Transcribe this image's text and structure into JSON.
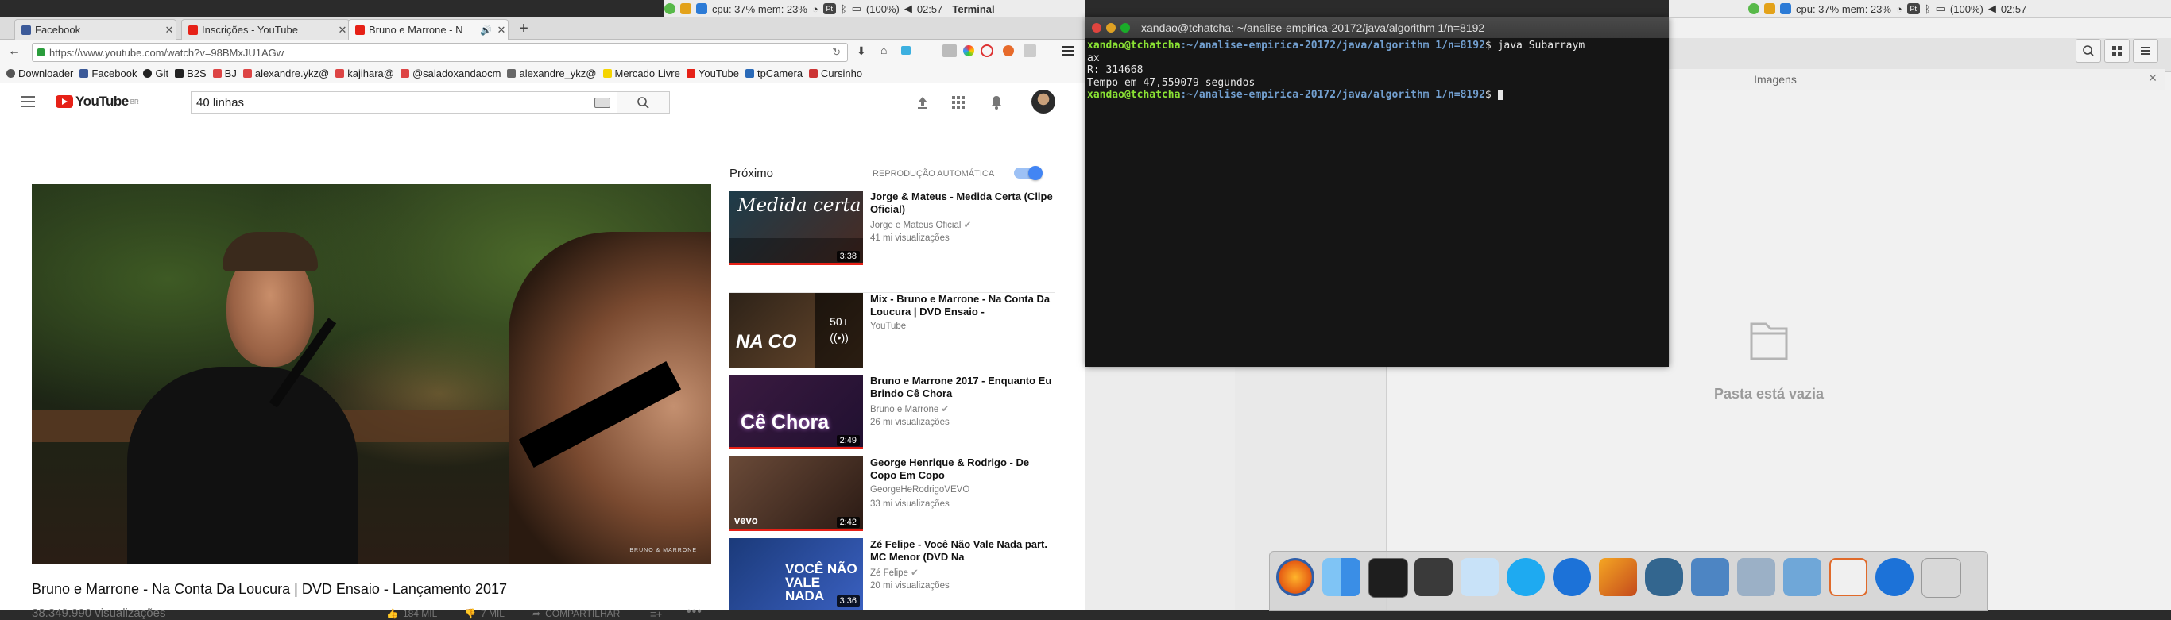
{
  "system_bar": {
    "stats": "cpu: 37% mem: 23%",
    "battery": "(100%)",
    "time": "02:57",
    "app_name": "Terminal",
    "right_stats": "cpu: 37% mem: 23%",
    "right_battery": "(100%)",
    "right_time": "02:57"
  },
  "browser": {
    "tabs": [
      {
        "label": "Facebook",
        "color": "#3b5998"
      },
      {
        "label": "Inscrições - YouTube",
        "color": "#e62117"
      },
      {
        "label": "Bruno e Marrone - N",
        "color": "#e62117"
      }
    ],
    "new_tab": "+",
    "url": "https://www.youtube.com/watch?v=98BMxJU1AGw",
    "bookmarks": [
      {
        "label": "Downloader",
        "color": "#555"
      },
      {
        "label": "Facebook",
        "color": "#3b5998"
      },
      {
        "label": "Git",
        "color": "#222"
      },
      {
        "label": "B2S",
        "color": "#222"
      },
      {
        "label": "BJ",
        "color": "#d44"
      },
      {
        "label": "alexandre.ykz@",
        "color": "#d44"
      },
      {
        "label": "kajihara@",
        "color": "#d44"
      },
      {
        "label": "@saladoxandaocm",
        "color": "#d44"
      },
      {
        "label": "alexandre_ykz@",
        "color": "#666"
      },
      {
        "label": "Mercado Livre",
        "color": "#f5d400"
      },
      {
        "label": "YouTube",
        "color": "#e62117"
      },
      {
        "label": "tpCamera",
        "color": "#2a6ab8"
      },
      {
        "label": "Cursinho",
        "color": "#c33"
      }
    ]
  },
  "youtube": {
    "logo_text": "YouTube",
    "logo_country": "BR",
    "search_value": "40 linhas",
    "video_title": "Bruno e Marrone - Na Conta Da Loucura | DVD Ensaio - Lançamento 2017",
    "views": "38.349.990 visualizações",
    "likes": "184 MIL",
    "dislikes": "7 MIL",
    "share": "COMPARTILHAR",
    "watermark": "BRUNO & MARRONE",
    "next_label": "Próximo",
    "autoplay_label": "REPRODUÇÃO AUTOMÁTICA",
    "recommendations": [
      {
        "title": "Jorge & Mateus - Medida Certa (Clipe Oficial)",
        "channel": "Jorge e Mateus Oficial",
        "views": "41 mi visualizações",
        "duration": "3:38",
        "thumb_text": "Medida certa",
        "verified": true
      },
      {
        "title": "Mix - Bruno e Marrone - Na Conta Da Loucura | DVD Ensaio -",
        "channel": "YouTube",
        "views": "",
        "duration": "",
        "thumb_text": "NA CO",
        "mix_count": "50+",
        "verified": false
      },
      {
        "title": "Bruno e Marrone 2017 - Enquanto Eu Brindo Cê Chora",
        "channel": "Bruno e Marrone",
        "views": "26 mi visualizações",
        "duration": "2:49",
        "thumb_text": "Cê Chora",
        "verified": true
      },
      {
        "title": "George Henrique & Rodrigo - De Copo Em Copo",
        "channel": "GeorgeHeRodrigoVEVO",
        "views": "33 mi visualizações",
        "duration": "2:42",
        "thumb_text": "vevo",
        "verified": false
      },
      {
        "title": "Zé Felipe - Você Não Vale Nada part. MC Menor (DVD Na",
        "channel": "Zé Felipe",
        "views": "20 mi visualizações",
        "duration": "3:36",
        "thumb_text": "VOCÊ NÃO VALE NADA",
        "verified": true
      }
    ]
  },
  "terminal": {
    "title": "xandao@tchatcha: ~/analise-empirica-20172/java/algorithm 1/n=8192",
    "prompt_user": "xandao@tchatcha",
    "prompt_path": ":~/analise-empirica-20172/java/algorithm 1/n=8192",
    "command": "$ java Subarraym",
    "command_wrap": "ax",
    "output_1": "R: 314668",
    "output_2": "Tempo em 47,559079 segundos",
    "prompt_end": "$ "
  },
  "files": {
    "panel_title": "Imagens",
    "empty_message": "Pasta está vazia"
  },
  "colors": {
    "youtube_red": "#e62117",
    "accent_blue": "#4285f4",
    "terminal_green": "#8ae234",
    "terminal_blue": "#729fcf"
  }
}
